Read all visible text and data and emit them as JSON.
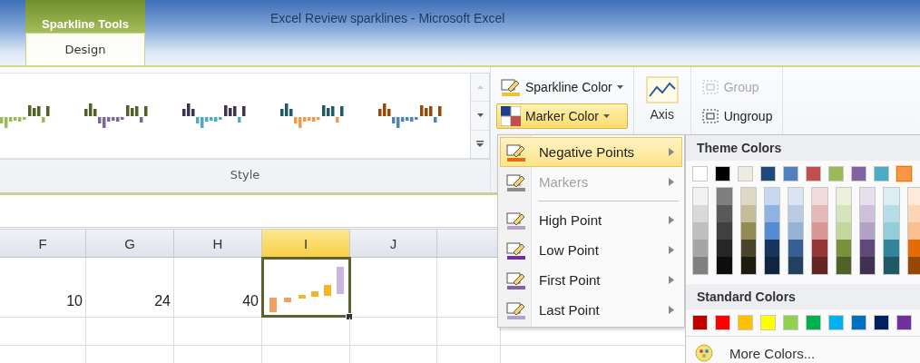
{
  "window": {
    "title": "Excel Review sparklines  -  Microsoft Excel"
  },
  "contextual_tab": {
    "group": "Sparkline Tools",
    "tabs": [
      {
        "label": "Design",
        "selected": true
      }
    ]
  },
  "ribbon": {
    "style_gallery": {
      "items": [
        {
          "selected": false,
          "bars": [
            {
              "kind": "positive",
              "color": "#4f6228"
            },
            {
              "kind": "negative",
              "color": "#9bbb59"
            }
          ]
        },
        {
          "selected": false,
          "bars": [
            {
              "kind": "positive",
              "color": "#4f6228"
            },
            {
              "kind": "negative",
              "color": "#8064a2"
            }
          ]
        },
        {
          "selected": false,
          "bars": [
            {
              "kind": "positive",
              "color": "#3f3151"
            },
            {
              "kind": "negative",
              "color": "#4bacc6"
            }
          ]
        },
        {
          "selected": false,
          "bars": [
            {
              "kind": "positive",
              "color": "#215968"
            },
            {
              "kind": "negative",
              "color": "#f79646"
            }
          ]
        },
        {
          "selected": false,
          "bars": [
            {
              "kind": "positive",
              "color": "#984807"
            },
            {
              "kind": "negative",
              "color": "#4f81bd"
            }
          ]
        }
      ],
      "group_label": "Style"
    },
    "buttons": [
      {
        "kind": "sparkline_color",
        "label": "Sparkline Color",
        "selected": false
      },
      {
        "kind": "marker_color",
        "label": "Marker Color",
        "selected": true
      }
    ],
    "axis": {
      "label": "Axis"
    },
    "group_buttons": [
      {
        "label": "Group",
        "disabled": true
      },
      {
        "label": "Ungroup",
        "disabled": false
      }
    ]
  },
  "sheet": {
    "columns": [
      {
        "label": "F",
        "selected": false
      },
      {
        "label": "G",
        "selected": false
      },
      {
        "label": "H",
        "selected": false
      },
      {
        "label": "I",
        "selected": true
      },
      {
        "label": "J",
        "selected": false
      }
    ],
    "rows": [
      {
        "cells": [
          {
            "kind": "number",
            "text": "10"
          },
          {
            "kind": "number",
            "text": "24"
          },
          {
            "kind": "number",
            "text": "40"
          },
          {
            "kind": "sparkline",
            "selected": true
          },
          {
            "kind": "empty"
          }
        ]
      }
    ]
  },
  "marker_menu": {
    "sections": [
      {
        "items": [
          {
            "label": "Negative Points",
            "selected": true,
            "disabled": false,
            "color": "#e46c0a"
          },
          {
            "label": "Markers",
            "selected": false,
            "disabled": true,
            "color": "#8c8c8c"
          }
        ]
      },
      {
        "items": [
          {
            "label": "High Point",
            "selected": false,
            "disabled": false,
            "color": "#b2a2c7"
          },
          {
            "label": "Low Point",
            "selected": false,
            "disabled": false,
            "color": "#7030a0"
          },
          {
            "label": "First Point",
            "selected": false,
            "disabled": false,
            "color": "#8064a2"
          },
          {
            "label": "Last Point",
            "selected": false,
            "disabled": false,
            "color": "#b2a2c7"
          }
        ]
      }
    ]
  },
  "color_palette": {
    "theme_heading": "Theme Colors",
    "theme_colors": [
      {
        "color": "#ffffff",
        "selected": false,
        "shades": [
          {
            "color": "#f2f2f2"
          },
          {
            "color": "#d9d9d9"
          },
          {
            "color": "#bfbfbf"
          },
          {
            "color": "#a6a6a6"
          },
          {
            "color": "#808080"
          }
        ]
      },
      {
        "color": "#000000",
        "selected": false,
        "shades": [
          {
            "color": "#7f7f7f"
          },
          {
            "color": "#595959"
          },
          {
            "color": "#404040"
          },
          {
            "color": "#262626"
          },
          {
            "color": "#0d0d0d"
          }
        ]
      },
      {
        "color": "#eeece1",
        "selected": false,
        "shades": [
          {
            "color": "#ddd9c3"
          },
          {
            "color": "#c4bd97"
          },
          {
            "color": "#948a54"
          },
          {
            "color": "#4a452a"
          },
          {
            "color": "#1d1b10"
          }
        ]
      },
      {
        "color": "#1f497d",
        "selected": false,
        "shades": [
          {
            "color": "#c6d9f0"
          },
          {
            "color": "#8db3e2"
          },
          {
            "color": "#548dd4"
          },
          {
            "color": "#17365d"
          },
          {
            "color": "#0f243e"
          }
        ]
      },
      {
        "color": "#4f81bd",
        "selected": false,
        "shades": [
          {
            "color": "#dbe5f1"
          },
          {
            "color": "#b8cce4"
          },
          {
            "color": "#95b3d7"
          },
          {
            "color": "#366092"
          },
          {
            "color": "#244061"
          }
        ]
      },
      {
        "color": "#c0504d",
        "selected": false,
        "shades": [
          {
            "color": "#f2dcdb"
          },
          {
            "color": "#e5b9b7"
          },
          {
            "color": "#d99694"
          },
          {
            "color": "#953734"
          },
          {
            "color": "#632423"
          }
        ]
      },
      {
        "color": "#9bbb59",
        "selected": false,
        "shades": [
          {
            "color": "#ebf1dd"
          },
          {
            "color": "#d7e3bc"
          },
          {
            "color": "#c3d69b"
          },
          {
            "color": "#76923c"
          },
          {
            "color": "#4f6128"
          }
        ]
      },
      {
        "color": "#8064a2",
        "selected": false,
        "shades": [
          {
            "color": "#e5e0ec"
          },
          {
            "color": "#ccc1d9"
          },
          {
            "color": "#b2a2c7"
          },
          {
            "color": "#5f497a"
          },
          {
            "color": "#3f3151"
          }
        ]
      },
      {
        "color": "#4bacc6",
        "selected": false,
        "shades": [
          {
            "color": "#dbeef3"
          },
          {
            "color": "#b7dde8"
          },
          {
            "color": "#92cddc"
          },
          {
            "color": "#31859b"
          },
          {
            "color": "#205867"
          }
        ]
      },
      {
        "color": "#f79646",
        "selected": true,
        "shades": [
          {
            "color": "#fdeada"
          },
          {
            "color": "#fbd5b5"
          },
          {
            "color": "#fac08f"
          },
          {
            "color": "#e36c09"
          },
          {
            "color": "#974806"
          }
        ]
      }
    ],
    "standard_heading": "Standard Colors",
    "standard_colors": [
      {
        "color": "#c00000",
        "selected": false
      },
      {
        "color": "#ff0000",
        "selected": false
      },
      {
        "color": "#ffc000",
        "selected": false
      },
      {
        "color": "#ffff00",
        "selected": false
      },
      {
        "color": "#92d050",
        "selected": false
      },
      {
        "color": "#00b050",
        "selected": false
      },
      {
        "color": "#00b0f0",
        "selected": false
      },
      {
        "color": "#0070c0",
        "selected": false
      },
      {
        "color": "#002060",
        "selected": false
      },
      {
        "color": "#7030a0",
        "selected": false
      }
    ],
    "more_colors": "More Colors..."
  }
}
